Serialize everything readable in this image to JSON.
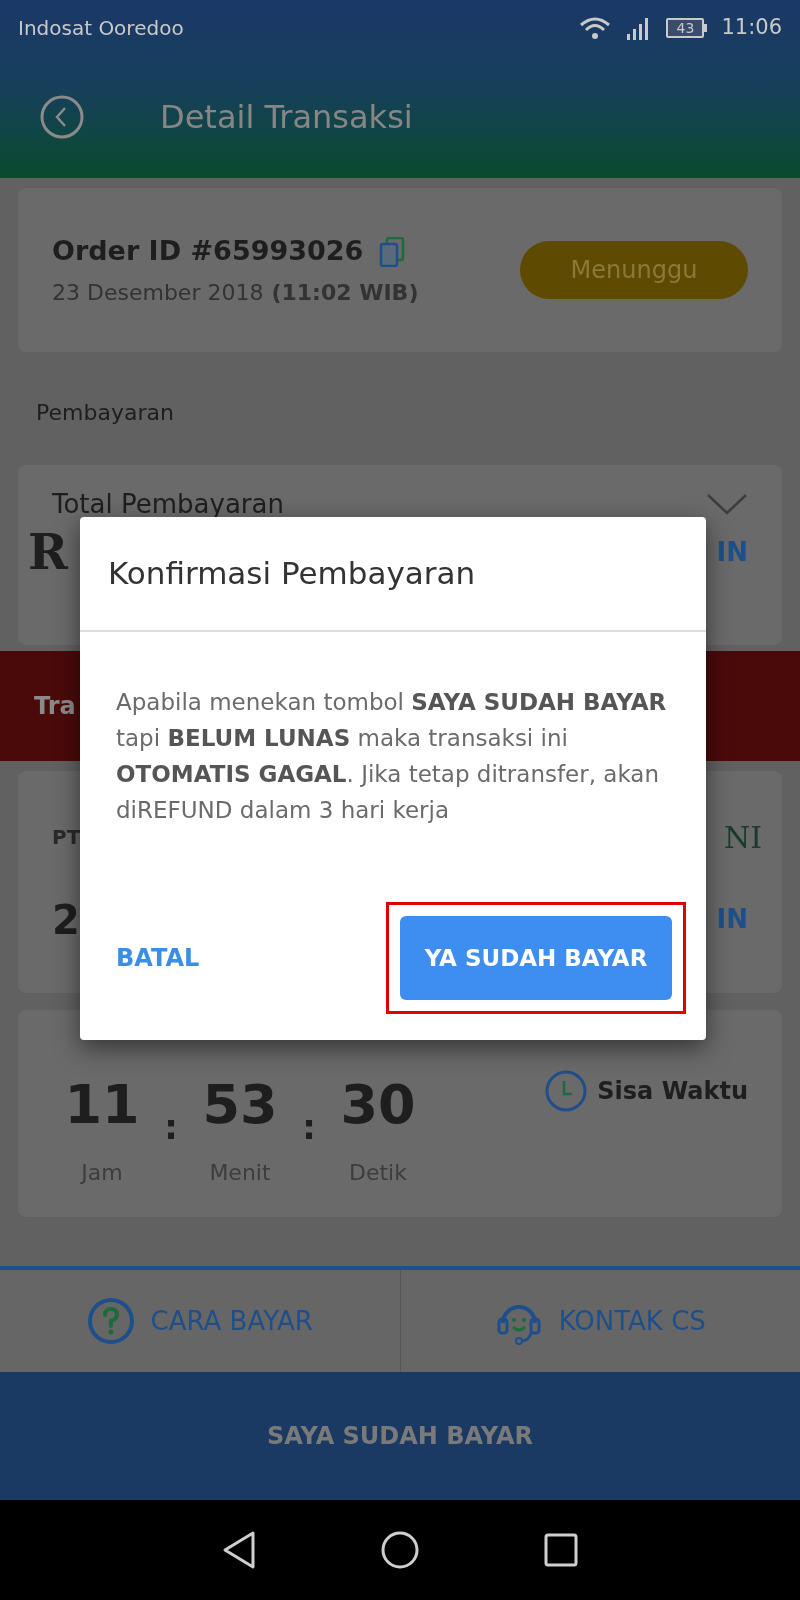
{
  "status_bar": {
    "carrier": "Indosat Ooredoo",
    "battery": "43",
    "time": "11:06"
  },
  "header": {
    "title": "Detail Transaksi"
  },
  "order": {
    "id": "Order ID #65993026",
    "date": "23 Desember 2018",
    "time": "(11:02 WIB)",
    "status": "Menunggu"
  },
  "section_label": "Pembayaran",
  "payment_card": {
    "label": "Total Pembayaran",
    "amount": "R",
    "action": "IN"
  },
  "notice_banner": {
    "text": "Tra"
  },
  "bank_card": {
    "name": "PT",
    "logo": "NI",
    "number": "2",
    "action": "IN"
  },
  "timer": {
    "units": [
      {
        "value": "11",
        "label": "Jam"
      },
      {
        "value": "53",
        "label": "Menit"
      },
      {
        "value": "30",
        "label": "Detik"
      }
    ],
    "separators": [
      ":",
      ":"
    ],
    "caption": "Sisa Waktu"
  },
  "bottom_tabs": [
    {
      "label": "CARA BAYAR",
      "kind": "help"
    },
    {
      "label": "KONTAK CS",
      "kind": "support"
    }
  ],
  "confirm_button": "SAYA SUDAH BAYAR",
  "dialog": {
    "title": "Konfirmasi Pembayaran",
    "message": "Apabila menekan tombol **SAYA SUDAH BAYAR** tapi **BELUM LUNAS** maka transaksi ini **OTOMATIS GAGAL**. Jika tetap ditransfer, akan diREFUND dalam 3 hari kerja",
    "cancel": "BATAL",
    "confirm": "YA SUDAH BAYAR",
    "confirm_highlighted": true
  }
}
